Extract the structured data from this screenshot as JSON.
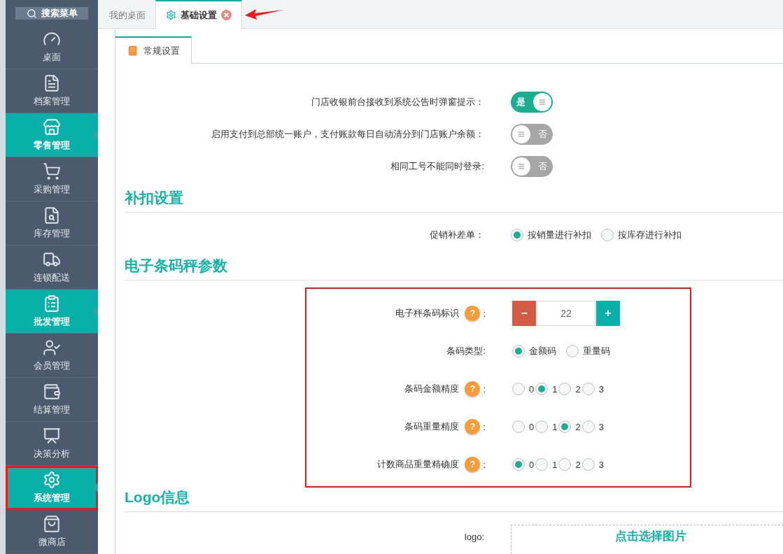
{
  "sidebar": {
    "search_button": "搜索菜单",
    "items": [
      {
        "label": "桌面",
        "selected": false,
        "highlighted": false
      },
      {
        "label": "档案管理",
        "selected": false,
        "highlighted": false
      },
      {
        "label": "零售管理",
        "selected": true,
        "highlighted": false
      },
      {
        "label": "采购管理",
        "selected": false,
        "highlighted": false
      },
      {
        "label": "库存管理",
        "selected": false,
        "highlighted": false
      },
      {
        "label": "连锁配送",
        "selected": false,
        "highlighted": false
      },
      {
        "label": "批发管理",
        "selected": true,
        "highlighted": false
      },
      {
        "label": "会员管理",
        "selected": false,
        "highlighted": false
      },
      {
        "label": "结算管理",
        "selected": false,
        "highlighted": false
      },
      {
        "label": "决策分析",
        "selected": false,
        "highlighted": false
      },
      {
        "label": "系统管理",
        "selected": true,
        "highlighted": true
      },
      {
        "label": "微商店",
        "selected": false,
        "highlighted": false
      }
    ]
  },
  "tabs": [
    {
      "label": "我的桌面",
      "selected": false
    },
    {
      "label": "基础设置",
      "selected": true
    }
  ],
  "subtabs": [
    {
      "label": "常规设置",
      "selected": true
    }
  ],
  "sections": [
    {
      "rows": [
        {
          "kind": "toggle",
          "label": "门店收银前台接收到系统公告时弹窗提示：",
          "on": true,
          "text": "是"
        },
        {
          "kind": "toggle",
          "label": "启用支付到总部统一账户，支付账款每日自动清分到门店账户余额：",
          "on": false,
          "text": "否"
        },
        {
          "kind": "toggle",
          "label": "相同工号不能同时登录:",
          "on": false,
          "text": "否"
        }
      ]
    },
    {
      "title": "补扣设置",
      "highlighted": false,
      "rows": [
        {
          "kind": "radio",
          "label": "促销补差单：",
          "options": [
            {
              "label": "按销量进行补扣",
              "selected": true
            },
            {
              "label": "按库存进行补扣",
              "selected": false
            }
          ]
        }
      ]
    },
    {
      "title": "电子条码秤参数",
      "highlighted": true,
      "rows": [
        {
          "kind": "stepper",
          "label": "电子秤条码标识",
          "help": "?",
          "colon": ":",
          "minus": "−",
          "value": "22",
          "plus": "+"
        },
        {
          "kind": "radio",
          "label": "条码类型:",
          "options": [
            {
              "label": "金额码",
              "selected": true
            },
            {
              "label": "重量码",
              "selected": false
            }
          ]
        },
        {
          "kind": "radio",
          "label": "条码金额精度",
          "help": "?",
          "colon": ":",
          "options": [
            {
              "label": "0",
              "selected": false
            },
            {
              "label": "1",
              "selected": true
            },
            {
              "label": "2",
              "selected": false
            },
            {
              "label": "3",
              "selected": false
            }
          ]
        },
        {
          "kind": "radio",
          "label": "条码重量精度",
          "help": "?",
          "colon": ":",
          "options": [
            {
              "label": "0",
              "selected": false
            },
            {
              "label": "1",
              "selected": false
            },
            {
              "label": "2",
              "selected": true
            },
            {
              "label": "3",
              "selected": false
            }
          ]
        },
        {
          "kind": "radio",
          "label": "计数商品重量精确度",
          "help": "?",
          "colon": ":",
          "options": [
            {
              "label": "0",
              "selected": true
            },
            {
              "label": "1",
              "selected": false
            },
            {
              "label": "2",
              "selected": false
            },
            {
              "label": "3",
              "selected": false
            }
          ]
        }
      ]
    },
    {
      "title": "Logo信息",
      "highlighted": false,
      "rows": [
        {
          "kind": "upload",
          "label": "logo:",
          "button": "点击选择图片"
        }
      ]
    }
  ]
}
